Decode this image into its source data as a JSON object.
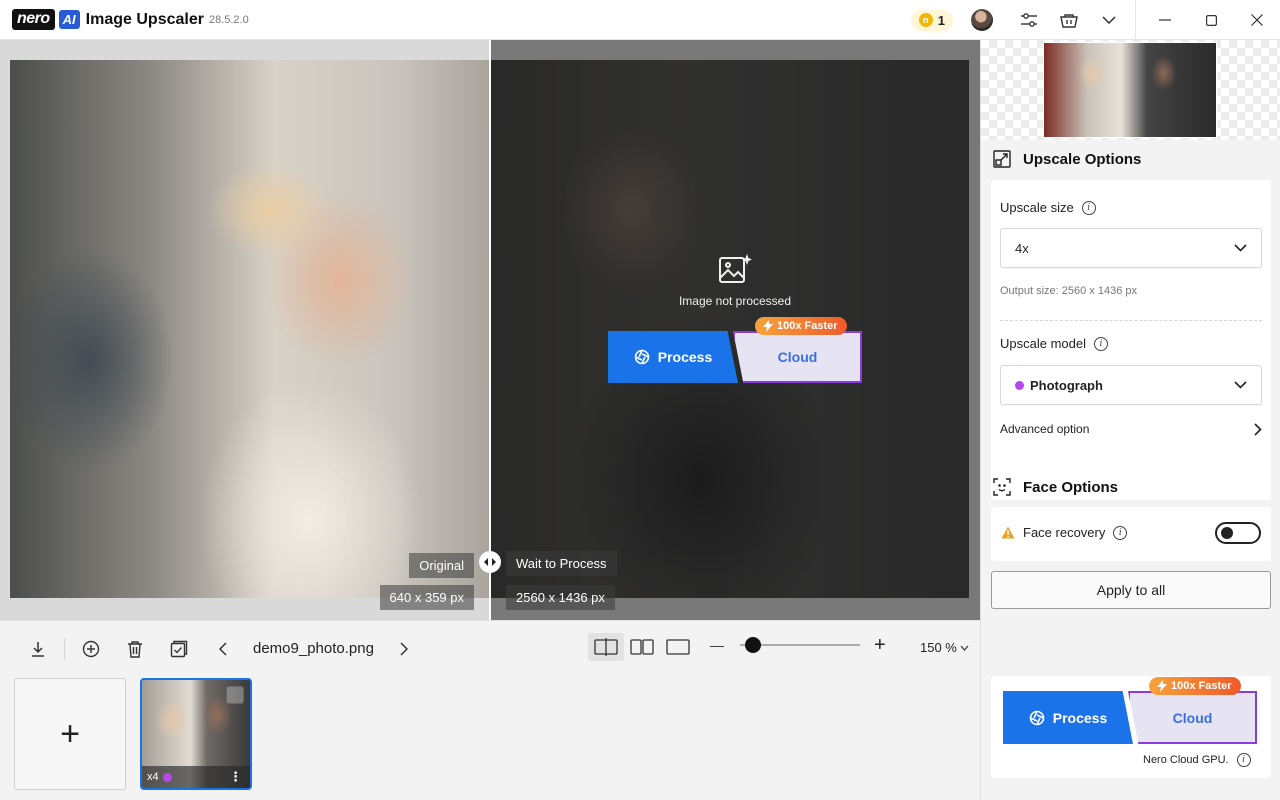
{
  "titlebar": {
    "logo_nero": "nero",
    "logo_ai": "AI",
    "app_name": "Image Upscaler",
    "version": "28.5.2.0",
    "credits": "1",
    "icons": [
      "coin-icon",
      "avatar",
      "settings-sliders-icon",
      "cart-icon",
      "chevron-down-icon",
      "minimize-icon",
      "maximize-icon",
      "close-icon"
    ]
  },
  "viewer": {
    "original_label": "Original",
    "original_dims": "640 x 359 px",
    "processed_label": "Wait to Process",
    "processed_dims": "2560 x 1436 px",
    "not_processed_text": "Image not processed",
    "process_label": "Process",
    "cloud_label": "Cloud",
    "faster_badge": "100x Faster"
  },
  "bottombar": {
    "file_name": "demo9_photo.png",
    "zoom_value": "150 %",
    "zoom_level": 0.05,
    "zoom_minus": "—",
    "zoom_plus": "+"
  },
  "thumbnails": {
    "add_label": "+",
    "items": [
      {
        "scale_label": "x4",
        "selected": true
      }
    ]
  },
  "panel": {
    "upscale_options_title": "Upscale Options",
    "upscale_size_label": "Upscale size",
    "upscale_size_value": "4x",
    "output_size_text": "Output size: 2560 x 1436 px",
    "upscale_model_label": "Upscale model",
    "upscale_model_value": "Photograph",
    "advanced_option_label": "Advanced option",
    "face_options_title": "Face Options",
    "face_recovery_label": "Face recovery",
    "face_recovery_enabled": false,
    "apply_all_label": "Apply to all",
    "process_label": "Process",
    "cloud_label": "Cloud",
    "faster_badge": "100x Faster",
    "cloud_gpu_text": "Nero Cloud GPU.",
    "colors": {
      "accent": "#1a73e8",
      "cloud_border": "#8a3be0",
      "badge": "#f27a2f",
      "model_dot": "#b548f0"
    }
  }
}
